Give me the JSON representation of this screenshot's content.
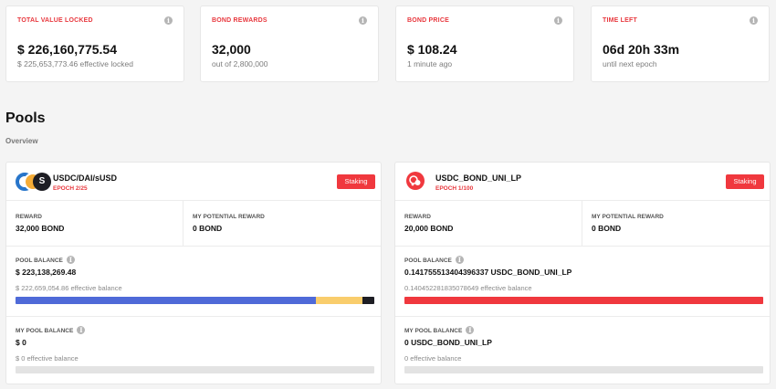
{
  "stats": [
    {
      "label": "TOTAL VALUE LOCKED",
      "value": "$ 226,160,775.54",
      "sub": "$ 225,653,773.46 effective locked"
    },
    {
      "label": "BOND REWARDS",
      "value": "32,000",
      "sub": "out of 2,800,000"
    },
    {
      "label": "BOND PRICE",
      "value": "$ 108.24",
      "sub": "1 minute ago"
    },
    {
      "label": "TIME LEFT",
      "value": "06d 20h 33m",
      "sub": "until next epoch"
    }
  ],
  "info_glyph": "i",
  "section": {
    "title": "Pools",
    "subtitle": "Overview"
  },
  "pools": [
    {
      "name": "USDC/DAI/sUSD",
      "epoch": "EPOCH 2/25",
      "status_label": "Staking",
      "reward_label": "REWARD",
      "reward_value": "32,000 BOND",
      "potential_label": "MY POTENTIAL REWARD",
      "potential_value": "0 BOND",
      "pool_balance_label": "POOL BALANCE",
      "pool_balance_value": "$ 223,138,269.48",
      "pool_balance_effective": "$ 222,659,054.86 effective balance",
      "pool_balance_shares": [
        {
          "token": "USDC",
          "fraction": 0.836,
          "color": "#4f6ad8"
        },
        {
          "token": "DAI",
          "fraction": 0.13,
          "color": "#f9cd6c"
        },
        {
          "token": "sUSD",
          "fraction": 0.034,
          "color": "#1e1e24"
        }
      ],
      "my_balance_label": "MY POOL BALANCE",
      "my_balance_value": "$ 0",
      "my_balance_effective": "$ 0 effective balance",
      "my_balance_fraction": 0,
      "icons": [
        "usdc-icon",
        "dai-icon",
        "susd-icon"
      ],
      "icon_glyph": "S"
    },
    {
      "name": "USDC_BOND_UNI_LP",
      "epoch": "EPOCH 1/100",
      "status_label": "Staking",
      "reward_label": "REWARD",
      "reward_value": "20,000 BOND",
      "potential_label": "MY POTENTIAL REWARD",
      "potential_value": "0 BOND",
      "pool_balance_label": "POOL BALANCE",
      "pool_balance_value": "0.141755513404396337 USDC_BOND_UNI_LP",
      "pool_balance_effective": "0.140452281835078649 effective balance",
      "pool_balance_shares": [
        {
          "token": "USDC_BOND_UNI_LP",
          "fraction": 1.0,
          "color": "#f0383e"
        }
      ],
      "my_balance_label": "MY POOL BALANCE",
      "my_balance_value": "0 USDC_BOND_UNI_LP",
      "my_balance_effective": "0 effective balance",
      "my_balance_fraction": 0,
      "icons": [
        "uniswap-lp-icon"
      ]
    }
  ],
  "colors": {
    "accent": "#e8383e",
    "staking_button": "#f0383e",
    "usdc": "#2775ca",
    "dai": "#f5ac37",
    "susd": "#1e1e24"
  }
}
